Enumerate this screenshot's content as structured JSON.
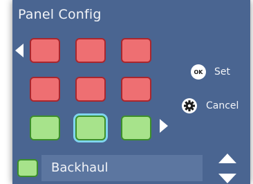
{
  "window": {
    "title": "Panel Config",
    "background": "#4a6591"
  },
  "grid": {
    "rows": [
      [
        "red",
        "red",
        "red"
      ],
      [
        "red",
        "red",
        "red"
      ],
      [
        "green",
        "green",
        "green"
      ]
    ],
    "selected": {
      "row": 2,
      "col": 1
    },
    "colors": {
      "red_fill": "#ee6f72",
      "red_border": "#a9262d",
      "green_fill": "#a7e38b",
      "green_border": "#3c8f2a",
      "selection": "#7fd5ee"
    },
    "left_arrow_icon": "chevron-left-icon",
    "right_arrow_icon": "chevron-right-icon"
  },
  "actions": {
    "set": {
      "icon": "ok-icon",
      "icon_text": "OK",
      "label": "Set"
    },
    "cancel": {
      "icon": "gear-icon",
      "label": "Cancel"
    }
  },
  "selector": {
    "swatch_color": "green",
    "name": "Backhaul",
    "up_icon": "triangle-up-icon",
    "down_icon": "triangle-down-icon"
  }
}
